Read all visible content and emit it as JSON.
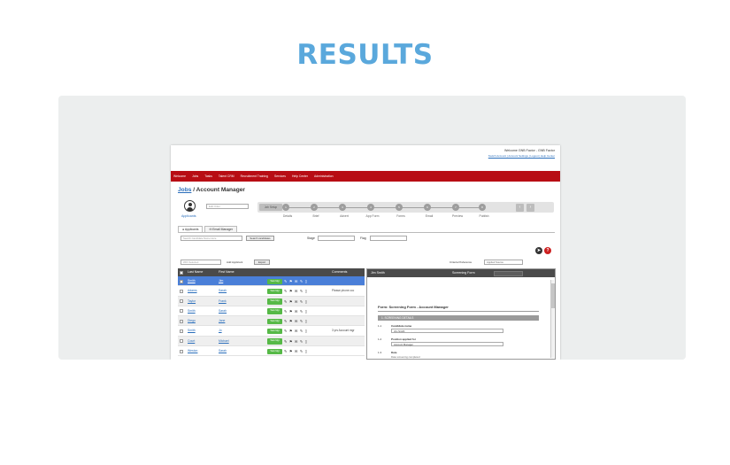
{
  "heading": "RESULTS",
  "app": {
    "welcome": "Welcome GNB Factor - GNB Factor",
    "top_links": "Switch Account | Account Settings | Logout | Help Center",
    "nav": [
      "Welcome",
      "Jobs",
      "Tasks",
      "Talent CRM",
      "Recruitment Training",
      "Services",
      "Help Center",
      "Administration"
    ],
    "breadcrumb": {
      "root": "Jobs",
      "separator": " / ",
      "current": "Account Manager"
    },
    "applicants_label": "Applicants",
    "list_select_placeholder": "Edit Order",
    "job_setup": "Job Setup",
    "steps": [
      "Details",
      "Brief",
      "Advert",
      "App Form",
      "Forms",
      "Email",
      "Preview",
      "Publish"
    ],
    "step_numbers": [
      "1",
      "2",
      "3",
      "4",
      "5",
      "6",
      "7",
      "8"
    ],
    "prev_icon": "‹",
    "next_icon": "›",
    "tabs": [
      "Applicants",
      "Email Manager"
    ],
    "search_placeholder": "Search Candidate Name Here",
    "search_button": "Search candidates",
    "stage_label": "Stage",
    "flag_label": "Flag",
    "bulk_action": "With Selected",
    "add_applicant": "Add Applicant",
    "export_button": "Export",
    "criteria_label": "Criteria Preference",
    "criteria_value": "Applied Source",
    "columns": {
      "last_name": "Last Name",
      "first_name": "First Name",
      "comments": "Comments"
    },
    "task_button": "Task Mgt",
    "row_icons": "✎ ⚑ ✉ ✎ ▯",
    "rows": [
      {
        "last": "Smith",
        "first": "Jim",
        "comment": ""
      },
      {
        "last": "Adams",
        "first": "Sarah",
        "comment": "Please phone ccc"
      },
      {
        "last": "Taylor",
        "first": "Frank",
        "comment": ""
      },
      {
        "last": "Smith",
        "first": "Sarah",
        "comment": ""
      },
      {
        "last": "Diego",
        "first": "Jane",
        "comment": ""
      },
      {
        "last": "Smith",
        "first": "Jo",
        "comment": "3 yrs Account mgr"
      },
      {
        "last": "Court",
        "first": "Michael",
        "comment": ""
      },
      {
        "last": "Weston",
        "first": "Sarah",
        "comment": ""
      }
    ],
    "detail": {
      "name": "Jim Smith",
      "form_label": "Screening Form",
      "form_title": "Form: Screening Form - Account Manager",
      "section": "1. SCREENING DETAILS",
      "questions": [
        {
          "num": "1.1",
          "label": "Candidate name",
          "value": "Jim Smith"
        },
        {
          "num": "1.2",
          "label": "Position applied for",
          "value": "Account Manager"
        },
        {
          "num": "1.3",
          "label": "Date",
          "value": "",
          "note": "Date screening completed"
        }
      ]
    }
  },
  "colors": {
    "heading": "#5aa8dc",
    "nav": "#b80d14",
    "selected_row": "#4a7fd8",
    "task_button": "#56b947"
  }
}
